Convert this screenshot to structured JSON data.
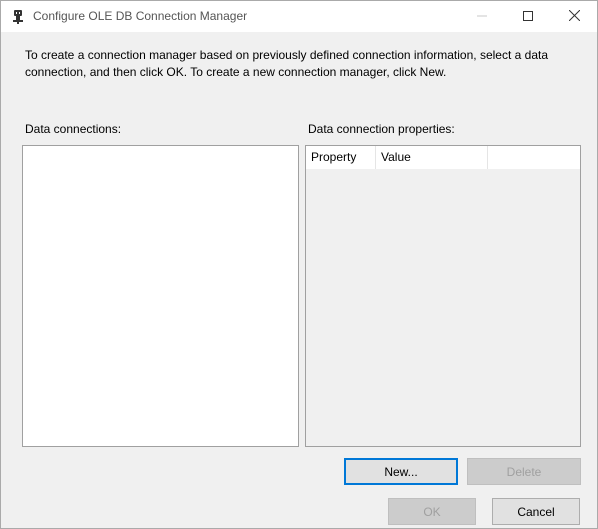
{
  "window": {
    "title": "Configure OLE DB Connection Manager",
    "icon": "database-plug-icon"
  },
  "description": "To create a connection manager based on previously defined connection information, select a data connection, and then click OK. To create a new connection manager, click New.",
  "data_connections": {
    "label": "Data connections:",
    "items": []
  },
  "properties": {
    "label": "Data connection properties:",
    "columns": [
      "Property",
      "Value",
      ""
    ],
    "rows": []
  },
  "buttons": {
    "new": "New...",
    "delete": "Delete",
    "ok": "OK",
    "cancel": "Cancel"
  },
  "colors": {
    "accent": "#0078d7",
    "disabled_text": "#a0a0a0",
    "dialog_bg": "#f0f0f0"
  }
}
